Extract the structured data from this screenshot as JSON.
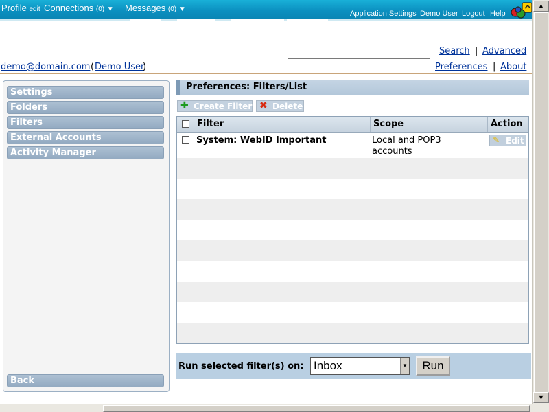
{
  "topbar": {
    "profile": "Profile",
    "profile_edit": "edit",
    "connections": "Connections",
    "connections_count": "(0)",
    "messages": "Messages",
    "messages_count": "(0)",
    "app_settings": "Application Settings",
    "user": "Demo User",
    "logout": "Logout",
    "help": "Help"
  },
  "search": {
    "value": "",
    "search_link": "Search",
    "advanced_link": "Advanced",
    "separator": "|"
  },
  "account": {
    "email": "demo@domain.com",
    "open_paren": "(",
    "name": "Demo User",
    "close_paren": ")"
  },
  "nav": {
    "preferences": "Preferences",
    "about": "About",
    "separator": "|"
  },
  "sidebar": {
    "items": [
      {
        "label": "Settings"
      },
      {
        "label": "Folders"
      },
      {
        "label": "Filters"
      },
      {
        "label": "External Accounts"
      },
      {
        "label": "Activity Manager"
      }
    ],
    "back": "Back"
  },
  "main": {
    "title": "Preferences: Filters/List",
    "create_filter": "Create Filter",
    "delete": "Delete",
    "columns": {
      "filter": "Filter",
      "scope": "Scope",
      "action": "Action"
    },
    "rows": [
      {
        "filter": "System: WebID Important",
        "scope_line1": "Local and POP3",
        "scope_line2": "accounts",
        "action": "Edit"
      }
    ],
    "run_label": "Run selected filter(s) on:",
    "run_target": "Inbox",
    "run_button": "Run"
  },
  "colors": {
    "topbar": "#0b8fbf",
    "sidebar_item": "#9fb4c8",
    "link": "#00339a",
    "runbar": "#b9cfe2"
  }
}
